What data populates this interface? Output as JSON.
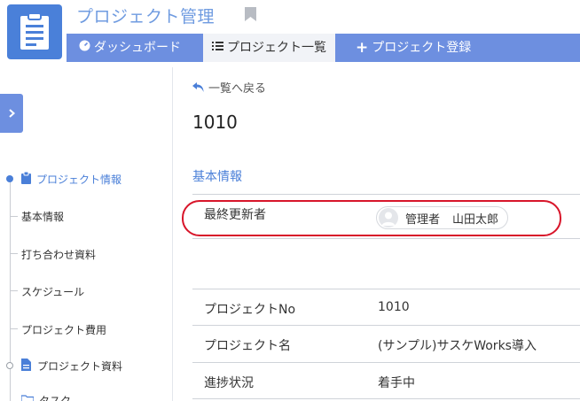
{
  "header": {
    "title": "プロジェクト管理"
  },
  "nav": {
    "items": [
      {
        "label": "ダッシュボード",
        "icon": "dashboard-gauge-icon"
      },
      {
        "label": "プロジェクト一覧",
        "icon": "list-icon",
        "active": true
      },
      {
        "label": "プロジェクト登録",
        "icon": "plus-icon"
      }
    ]
  },
  "sidebar": {
    "items": [
      {
        "label": "プロジェクト情報",
        "type": "section",
        "icon": "clipboard-icon"
      },
      {
        "label": "基本情報",
        "type": "item"
      },
      {
        "label": "打ち合わせ資料",
        "type": "item"
      },
      {
        "label": "スケジュール",
        "type": "item"
      },
      {
        "label": "プロジェクト費用",
        "type": "item"
      },
      {
        "label": "プロジェクト資料",
        "type": "section",
        "icon": "document-icon"
      },
      {
        "label": "タスク",
        "type": "item",
        "icon": "folder-icon"
      }
    ]
  },
  "main": {
    "back_label": "一覧へ戻る",
    "record_no": "1010",
    "section_title": "基本情報",
    "last_updated": {
      "label": "最終更新者",
      "role": "管理者",
      "name": "山田太郎"
    },
    "fields": [
      {
        "label": "プロジェクトNo",
        "value": "1010"
      },
      {
        "label": "プロジェクト名",
        "value": "(サンプル)サスケWorks導入"
      },
      {
        "label": "進捗状況",
        "value": "着手中"
      }
    ]
  },
  "colors": {
    "accent": "#6d8fe0",
    "link": "#4a7fd8",
    "highlight": "#d8152a"
  }
}
